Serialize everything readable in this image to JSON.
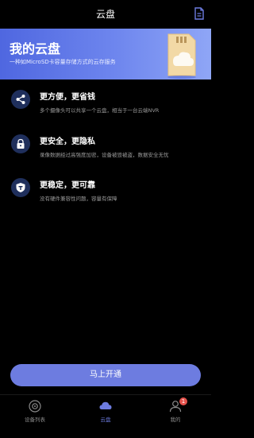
{
  "header": {
    "title": "云盘"
  },
  "banner": {
    "title": "我的云盘",
    "subtitle": "一种如MicroSD卡容量存储方式的云存服务"
  },
  "features": [
    {
      "icon": "share-icon",
      "title": "更方便，更省钱",
      "desc": "多个摄像头可以共享一个云盘，相当于一台云端NVR"
    },
    {
      "icon": "lock-icon",
      "title": "更安全，更隐私",
      "desc": "录像数据经过高强度加密，设备被毁被盗，数据安全无忧"
    },
    {
      "icon": "shield-icon",
      "title": "更稳定，更可靠",
      "desc": "没有硬件兼容性问题，容量有保障"
    }
  ],
  "cta": {
    "label": "马上开通"
  },
  "tabbar": {
    "items": [
      {
        "label": "设备列表",
        "icon": "device-list-icon",
        "active": false
      },
      {
        "label": "云盘",
        "icon": "cloud-icon",
        "active": true
      },
      {
        "label": "我的",
        "icon": "profile-icon",
        "active": false,
        "badge": "1"
      }
    ]
  },
  "colors": {
    "accent": "#6d7ce0",
    "background": "#000000",
    "badge": "#e5524c"
  }
}
